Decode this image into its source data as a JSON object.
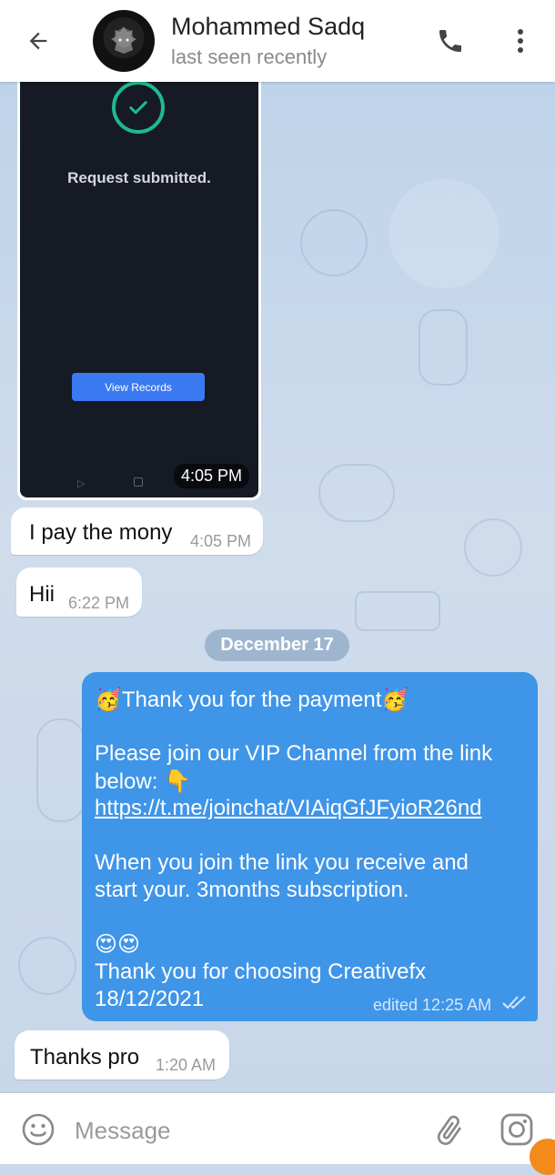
{
  "header": {
    "contact_name": "Mohammed Sadq",
    "status": "last seen recently"
  },
  "image_message": {
    "screen_title": "Request submitted.",
    "screen_button": "View Records",
    "time": "4:05 PM"
  },
  "messages_incoming": [
    {
      "text": "I pay the mony",
      "time": "4:05 PM"
    },
    {
      "text": "Hii",
      "time": "6:22 PM"
    }
  ],
  "date_separator": "December 17",
  "outgoing_message": {
    "line1": "🥳Thank you for the payment🥳",
    "line2": "Please join our VIP Channel from the link",
    "line3": "below: 👇",
    "link": "https://t.me/joinchat/VIAiqGfJFyioR26nd",
    "line4": "When you join the link you receive and",
    "line5": "start your. 3months subscription.",
    "line6": "😍😍",
    "line7": "Thank you for choosing Creativefx",
    "line8": "18/12/2021",
    "meta": "edited 12:25 AM"
  },
  "last_incoming": {
    "text": "Thanks pro",
    "time": "1:20 AM"
  },
  "composer": {
    "placeholder": "Message"
  },
  "colors": {
    "outgoing_bubble": "#3f95e8",
    "header_bg": "#ffffff",
    "accent": "#f28a1c"
  },
  "icons": [
    "back-arrow-icon",
    "phone-icon",
    "more-vert-icon",
    "emoji-icon",
    "paperclip-icon",
    "instagram-icon",
    "double-check-icon",
    "checkmark-icon"
  ]
}
